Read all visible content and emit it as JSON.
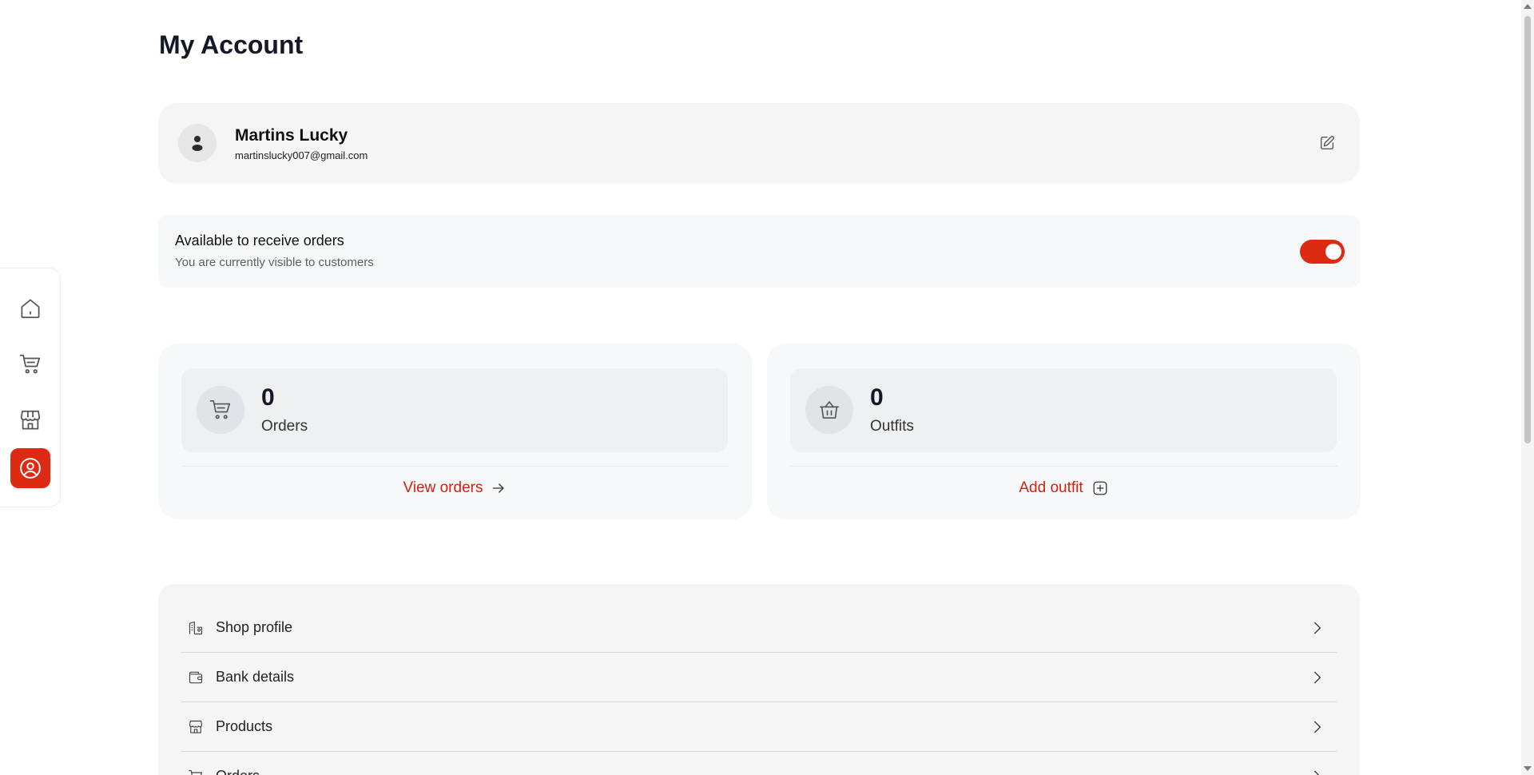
{
  "page": {
    "title": "My Account"
  },
  "sidebar": {
    "items": [
      {
        "name": "home",
        "icon": "home-icon",
        "active": false
      },
      {
        "name": "orders",
        "icon": "cart-icon",
        "active": false
      },
      {
        "name": "products",
        "icon": "storefront-icon",
        "active": false
      },
      {
        "name": "account",
        "icon": "user-circle-icon",
        "active": true
      }
    ]
  },
  "profile": {
    "name": "Martins Lucky",
    "email": "martinslucky007@gmail.com"
  },
  "availability": {
    "title": "Available to receive orders",
    "subtitle": "You are currently visible to customers",
    "enabled": true
  },
  "stats": {
    "orders": {
      "value": "0",
      "label": "Orders",
      "action": "View orders"
    },
    "outfits": {
      "value": "0",
      "label": "Outfits",
      "action": "Add outfit"
    }
  },
  "menu": {
    "items": [
      {
        "label": "Shop profile",
        "icon": "shop-profile-icon"
      },
      {
        "label": "Bank details",
        "icon": "wallet-icon"
      },
      {
        "label": "Products",
        "icon": "storefront-icon"
      },
      {
        "label": "Orders",
        "icon": "cart-icon"
      }
    ]
  },
  "colors": {
    "accent": "#dc2a13",
    "card_bg": "#f5f5f5"
  }
}
